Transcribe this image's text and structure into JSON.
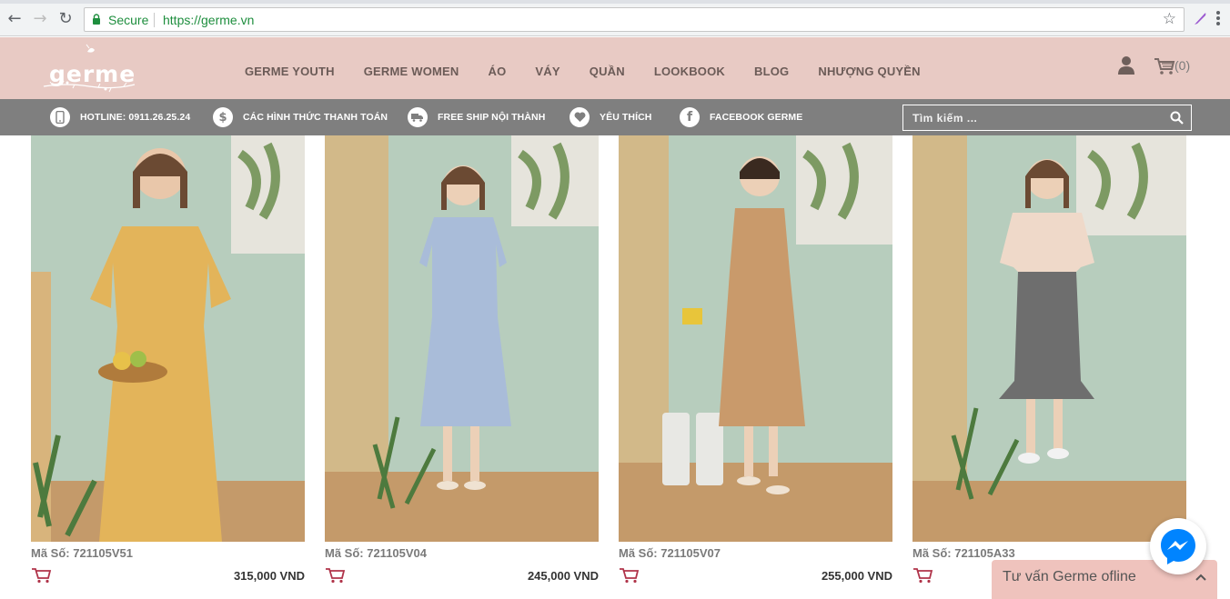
{
  "browser": {
    "secure_label": "Secure",
    "url": "https://germe.vn"
  },
  "header": {
    "logo_text": "germe",
    "nav": [
      "GERME YOUTH",
      "GERME WOMEN",
      "ÁO",
      "VÁY",
      "QUẦN",
      "LOOKBOOK",
      "BLOG",
      "NHƯỢNG QUYỀN"
    ],
    "cart_count": "(0)"
  },
  "info_bar": {
    "hotline": "HOTLINE: 0911.26.25.24",
    "payment": "CÁC HÌNH THỨC THANH TOÁN",
    "shipping": "FREE SHIP NỘI THÀNH",
    "favorites": "YÊU THÍCH",
    "facebook": "FACEBOOK GERME",
    "search_placeholder": "Tìm kiếm ..."
  },
  "products": [
    {
      "code": "Mã Số: 721105V51",
      "price": "315,000 VND",
      "outfit_color": "#e3b45a"
    },
    {
      "code": "Mã Số: 721105V04",
      "price": "245,000 VND",
      "outfit_color": "#a9bcd9"
    },
    {
      "code": "Mã Số: 721105V07",
      "price": "255,000 VND",
      "outfit_color": "#c99a6b"
    },
    {
      "code": "Mã Số: 721105A33",
      "price": "",
      "outfit_color": "#6e6e6e"
    }
  ],
  "chat": {
    "label": "Tư vấn Germe ofline"
  },
  "colors": {
    "header_bg": "#e8cac4",
    "info_bar_bg": "#7f7f7f",
    "nav_text": "#6b5b57",
    "wall_green": "#b9cfc0",
    "messenger_blue": "#0084ff"
  }
}
